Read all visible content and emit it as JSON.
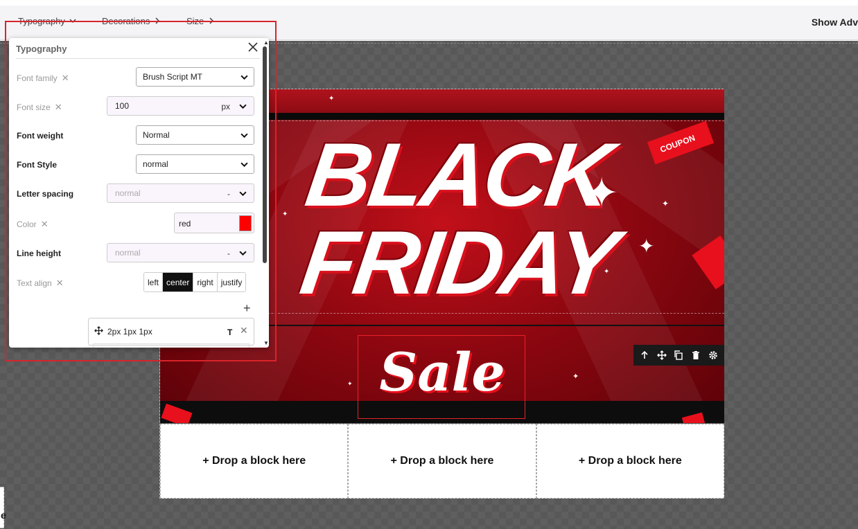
{
  "toolbar": {
    "menus": [
      {
        "label": "Typography",
        "icon": "chevron-down-icon"
      },
      {
        "label": "Decorations",
        "icon": "chevron-right-icon"
      },
      {
        "label": "Size",
        "icon": "chevron-right-icon"
      }
    ],
    "show_advanced": "Show Adv"
  },
  "panel": {
    "title": "Typography",
    "properties": {
      "font_family": {
        "label": "Font family",
        "value": "Brush Script MT"
      },
      "font_size": {
        "label": "Font size",
        "value": "100",
        "unit": "px"
      },
      "font_weight": {
        "label": "Font weight",
        "value": "Normal"
      },
      "font_style": {
        "label": "Font Style",
        "value": "normal"
      },
      "letter_spacing": {
        "label": "Letter spacing",
        "value": "normal",
        "unit": "-"
      },
      "color": {
        "label": "Color",
        "value": "red",
        "swatch": "#ff0000"
      },
      "line_height": {
        "label": "Line height",
        "value": "normal",
        "unit": "-"
      },
      "text_align": {
        "label": "Text align",
        "options": [
          "left",
          "center",
          "right",
          "justify"
        ],
        "selected": "center"
      }
    },
    "text_shadow_layer": {
      "value": "2px 1px 1px",
      "icon_label": "T"
    }
  },
  "hero": {
    "line1": "BLACK",
    "line2": "FRIDAY",
    "sale": "Sale",
    "coupon_text": "COUPON"
  },
  "block_tools": [
    "arrow-up-icon",
    "move-icon",
    "copy-icon",
    "trash-icon",
    "gear-icon"
  ],
  "drop_zones": [
    "+ Drop a block here",
    "+ Drop a block here",
    "+ Drop a block here"
  ],
  "left_stub_text": "e",
  "colors": {
    "accent_red": "#d9232a",
    "hero_red": "#b0131c",
    "toolbar_bg": "#f4f4f6"
  }
}
